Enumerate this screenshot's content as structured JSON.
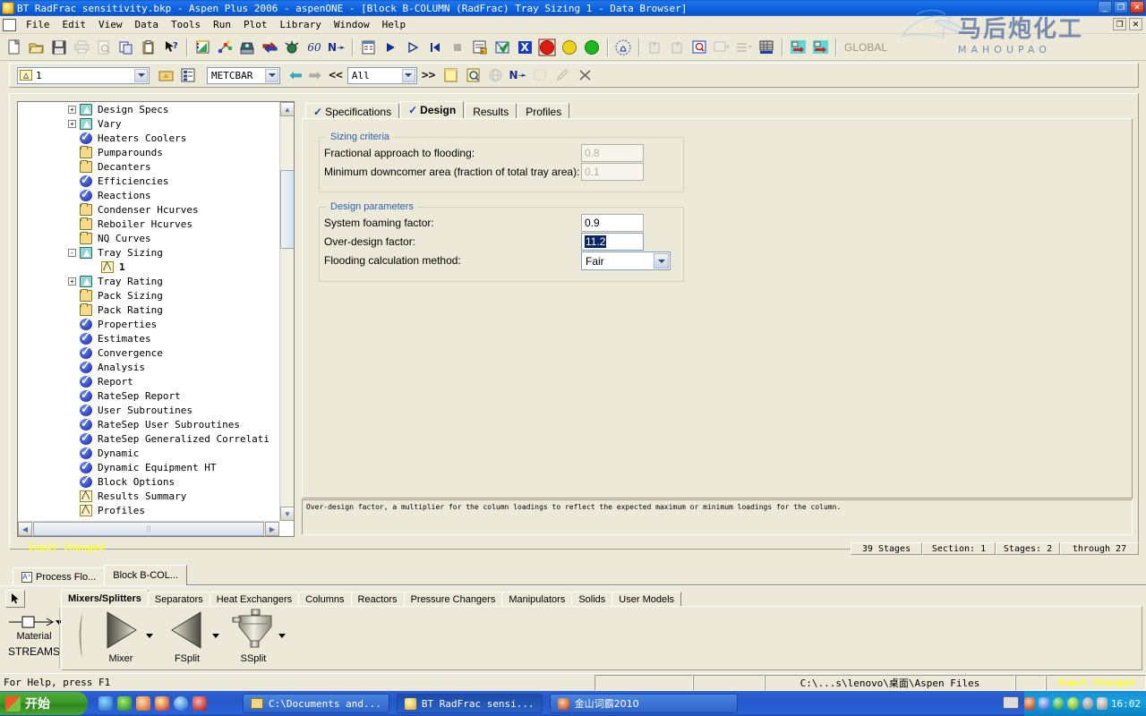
{
  "window": {
    "title": "BT RadFrac sensitivity.bkp - Aspen Plus 2006 - aspenONE - [Block B-COLUMN (RadFrac) Tray Sizing 1 - Data Browser]",
    "minimize": "_",
    "restore": "❐",
    "close": "✕",
    "inner_restore": "❐",
    "inner_close": "✕"
  },
  "menu": {
    "items": [
      {
        "label": "File"
      },
      {
        "label": "Edit"
      },
      {
        "label": "View"
      },
      {
        "label": "Data"
      },
      {
        "label": "Tools"
      },
      {
        "label": "Run"
      },
      {
        "label": "Plot"
      },
      {
        "label": "Library"
      },
      {
        "label": "Window"
      },
      {
        "label": "Help"
      }
    ]
  },
  "toolbar": {
    "global_label": "GLOBAL",
    "buttons": [
      {
        "name": "new-file",
        "glyph": "🗋"
      },
      {
        "name": "open-file",
        "glyph": "🗁"
      },
      {
        "name": "save-file",
        "glyph": "💾"
      },
      {
        "name": "print",
        "glyph": "🖨"
      },
      {
        "name": "print-preview",
        "glyph": "🔍"
      },
      {
        "name": "copy",
        "glyph": "⧉"
      },
      {
        "name": "paste",
        "glyph": "📋"
      },
      {
        "name": "whats-this",
        "glyph": "?"
      },
      {
        "name": "properties-chart",
        "glyph": "📊"
      },
      {
        "name": "flowsheet",
        "glyph": "⚛"
      },
      {
        "name": "data-browser",
        "glyph": "🗃"
      },
      {
        "name": "stream-table",
        "glyph": "⇄"
      },
      {
        "name": "streams",
        "glyph": "⚲"
      },
      {
        "name": "plot-wizard",
        "glyph": "60"
      },
      {
        "name": "next",
        "glyph": "N▸"
      },
      {
        "name": "input-summary",
        "glyph": "▤"
      },
      {
        "name": "run",
        "glyph": "▶"
      },
      {
        "name": "step",
        "glyph": "▷"
      },
      {
        "name": "reinitialize",
        "glyph": "|◀"
      },
      {
        "name": "stop",
        "glyph": "■"
      },
      {
        "name": "control-panel",
        "glyph": "▥"
      },
      {
        "name": "check-results",
        "glyph": "☑"
      },
      {
        "name": "excel-export",
        "glyph": "X"
      },
      {
        "name": "status-red",
        "glyph": ""
      },
      {
        "name": "status-yellow",
        "glyph": ""
      },
      {
        "name": "status-green",
        "glyph": ""
      },
      {
        "name": "unit-sets",
        "glyph": "◎"
      },
      {
        "name": "zoom-in",
        "glyph": "⊕"
      },
      {
        "name": "zoom-out",
        "glyph": "⊖"
      },
      {
        "name": "zoom-full",
        "glyph": "🔎"
      },
      {
        "name": "annotation",
        "glyph": "▣"
      },
      {
        "name": "line-style",
        "glyph": "≡"
      },
      {
        "name": "grid",
        "glyph": "▩"
      },
      {
        "name": "import-stream",
        "glyph": "⇥"
      },
      {
        "name": "export-stream",
        "glyph": "⇤"
      }
    ]
  },
  "browserbar": {
    "object_value": "1",
    "units_value": "METCBAR",
    "view_value": "All",
    "back_glyph": "⬅",
    "forward_glyph": "➡",
    "prev_glyph": "<<",
    "next_glyph": ">>",
    "buttons": [
      {
        "name": "parent-folder",
        "glyph": "🗂"
      },
      {
        "name": "tree-view",
        "glyph": "▤"
      },
      {
        "name": "notes",
        "glyph": "🗒"
      },
      {
        "name": "annotate",
        "glyph": "📝"
      },
      {
        "name": "globe",
        "glyph": "🌐"
      },
      {
        "name": "next-input",
        "glyph": "N▸"
      },
      {
        "name": "select-tool",
        "glyph": "▦"
      },
      {
        "name": "edit-tool",
        "glyph": "✎"
      },
      {
        "name": "delete-tool",
        "glyph": "✕"
      }
    ]
  },
  "tree": {
    "nodes": [
      {
        "label": "Design Specs",
        "icon": "triangle-teal",
        "expander": "+",
        "indent": 0,
        "selected": false
      },
      {
        "label": "Vary",
        "icon": "triangle-teal",
        "expander": "+",
        "indent": 0,
        "selected": false
      },
      {
        "label": "Heaters Coolers",
        "icon": "check",
        "expander": "",
        "indent": 0,
        "selected": false
      },
      {
        "label": "Pumparounds",
        "icon": "folder",
        "expander": "",
        "indent": 0,
        "selected": false
      },
      {
        "label": "Decanters",
        "icon": "folder",
        "expander": "",
        "indent": 0,
        "selected": false
      },
      {
        "label": "Efficiencies",
        "icon": "check",
        "expander": "",
        "indent": 0,
        "selected": false
      },
      {
        "label": "Reactions",
        "icon": "check",
        "expander": "",
        "indent": 0,
        "selected": false
      },
      {
        "label": "Condenser Hcurves",
        "icon": "folder",
        "expander": "",
        "indent": 0,
        "selected": false
      },
      {
        "label": "Reboiler Hcurves",
        "icon": "folder",
        "expander": "",
        "indent": 0,
        "selected": false
      },
      {
        "label": "NQ Curves",
        "icon": "folder",
        "expander": "",
        "indent": 0,
        "selected": false
      },
      {
        "label": "Tray Sizing",
        "icon": "triangle-teal",
        "expander": "-",
        "indent": 0,
        "selected": false
      },
      {
        "label": "1",
        "icon": "triangle-yellow",
        "expander": "",
        "indent": 1,
        "selected": true
      },
      {
        "label": "Tray Rating",
        "icon": "triangle-teal",
        "expander": "+",
        "indent": 0,
        "selected": false
      },
      {
        "label": "Pack Sizing",
        "icon": "folder",
        "expander": "",
        "indent": 0,
        "selected": false
      },
      {
        "label": "Pack Rating",
        "icon": "folder",
        "expander": "",
        "indent": 0,
        "selected": false
      },
      {
        "label": "Properties",
        "icon": "check",
        "expander": "",
        "indent": 0,
        "selected": false
      },
      {
        "label": "Estimates",
        "icon": "check",
        "expander": "",
        "indent": 0,
        "selected": false
      },
      {
        "label": "Convergence",
        "icon": "check",
        "expander": "",
        "indent": 0,
        "selected": false
      },
      {
        "label": "Analysis",
        "icon": "check",
        "expander": "",
        "indent": 0,
        "selected": false
      },
      {
        "label": "Report",
        "icon": "check",
        "expander": "",
        "indent": 0,
        "selected": false
      },
      {
        "label": "RateSep Report",
        "icon": "check",
        "expander": "",
        "indent": 0,
        "selected": false
      },
      {
        "label": "User Subroutines",
        "icon": "check",
        "expander": "",
        "indent": 0,
        "selected": false
      },
      {
        "label": "RateSep User Subroutines",
        "icon": "check",
        "expander": "",
        "indent": 0,
        "selected": false
      },
      {
        "label": "RateSep Generalized Correlati",
        "icon": "check",
        "expander": "",
        "indent": 0,
        "selected": false
      },
      {
        "label": "Dynamic",
        "icon": "check",
        "expander": "",
        "indent": 0,
        "selected": false
      },
      {
        "label": "Dynamic Equipment HT",
        "icon": "check",
        "expander": "",
        "indent": 0,
        "selected": false
      },
      {
        "label": "Block Options",
        "icon": "check",
        "expander": "",
        "indent": 0,
        "selected": false
      },
      {
        "label": "Results Summary",
        "icon": "triangle-yellow",
        "expander": "",
        "indent": 0,
        "selected": false
      },
      {
        "label": "Profiles",
        "icon": "triangle-yellow",
        "expander": "",
        "indent": 0,
        "selected": false
      }
    ],
    "input_changed": "Input Changed"
  },
  "form": {
    "tabs": [
      {
        "label": "Specifications",
        "checked": true,
        "active": false
      },
      {
        "label": "Design",
        "checked": true,
        "active": true
      },
      {
        "label": "Results",
        "checked": false,
        "active": false
      },
      {
        "label": "Profiles",
        "checked": false,
        "active": false
      }
    ],
    "sizing_criteria": {
      "title": "Sizing criteria",
      "fields": [
        {
          "label": "Fractional approach to flooding:",
          "value": "0.8",
          "disabled": true
        },
        {
          "label": "Minimum downcomer area (fraction of total tray area):",
          "value": "0.1",
          "disabled": true
        }
      ]
    },
    "design_parameters": {
      "title": "Design parameters",
      "fields": [
        {
          "label": "System foaming factor:",
          "value": "0.9",
          "disabled": false,
          "selected": false
        },
        {
          "label": "Over-design factor:",
          "value": "11.2",
          "disabled": false,
          "selected": true
        }
      ],
      "combo": {
        "label": "Flooding calculation method:",
        "value": "Fair"
      }
    },
    "help_text": "Over-design factor, a multiplier for the column loadings to reflect the expected maximum or minimum loadings for the column."
  },
  "stagebar": {
    "cells": [
      "39 Stages",
      "Section: 1",
      "Stages: 2",
      "through 27"
    ]
  },
  "doctabs": [
    {
      "label": "Process Flo...",
      "active": false,
      "icon": "A+"
    },
    {
      "label": "Block B-COL...",
      "active": true,
      "icon": ""
    }
  ],
  "palette": {
    "streams_label1": "Material",
    "streams_label2": "STREAMS",
    "tabs": [
      {
        "label": "Mixers/Splitters",
        "active": true
      },
      {
        "label": "Separators",
        "active": false
      },
      {
        "label": "Heat Exchangers",
        "active": false
      },
      {
        "label": "Columns",
        "active": false
      },
      {
        "label": "Reactors",
        "active": false
      },
      {
        "label": "Pressure Changers",
        "active": false
      },
      {
        "label": "Manipulators",
        "active": false
      },
      {
        "label": "Solids",
        "active": false
      },
      {
        "label": "User Models",
        "active": false
      }
    ],
    "items": [
      {
        "label": "Mixer",
        "shape": "triangle-right"
      },
      {
        "label": "FSplit",
        "shape": "triangle-left"
      },
      {
        "label": "SSplit",
        "shape": "vessel"
      }
    ]
  },
  "statusbar": {
    "help_text": "For Help, press F1",
    "path": "C:\\...s\\lenovo\\桌面\\Aspen Files",
    "changed": "Input Changed"
  },
  "taskbar": {
    "start_label": "开始",
    "tasks": [
      {
        "label": "C:\\Documents and...",
        "active": false
      },
      {
        "label": "BT RadFrac sensi...",
        "active": true
      },
      {
        "label": "金山词霸2010",
        "active": false
      }
    ],
    "clock": "16:02"
  },
  "watermark": {
    "text": "马后炮化工",
    "sub": "MAHOUPAO"
  },
  "colors": {
    "title_blue": "#0f63e0",
    "face": "#ece9d8",
    "group_title": "#2f5ea8",
    "selection": "#0a246a",
    "warning_yellow": "#ffff33"
  }
}
